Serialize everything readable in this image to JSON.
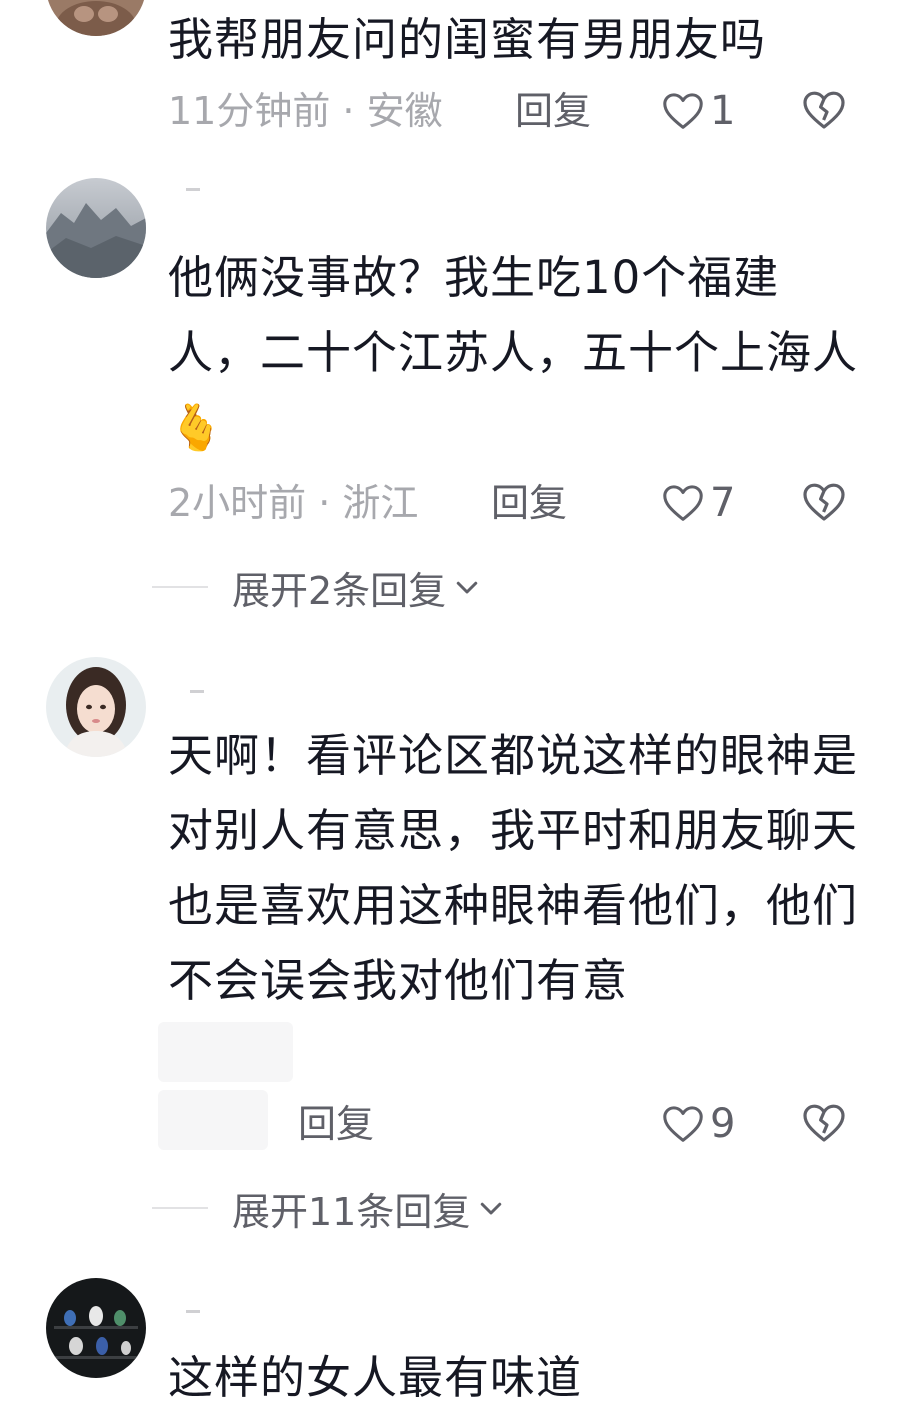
{
  "comments": [
    {
      "text": "我帮朋友问的闺蜜有男朋友吗",
      "meta": "11分钟前 · 安徽",
      "reply_label": "回复",
      "likes": "1"
    },
    {
      "text": "他俩没事故？我生吃10个福建人，二十个江苏人，五十个上海人",
      "emoji": "🫰",
      "meta": "2小时前 · 浙江",
      "reply_label": "回复",
      "likes": "7",
      "expand_label": "展开2条回复"
    },
    {
      "text": "天啊！看评论区都说这样的眼神是对别人有意思，我平时和朋友聊天也是喜欢用这种眼神看他们，他们不会误会我对他们有意",
      "reply_label": "回复",
      "likes": "9",
      "expand_label": "展开11条回复"
    },
    {
      "text": "这样的女人最有味道"
    }
  ],
  "colors": {
    "text": "#161823",
    "meta": "#a7a8ad",
    "action": "#5f6068",
    "divider": "#e2e2e4"
  }
}
